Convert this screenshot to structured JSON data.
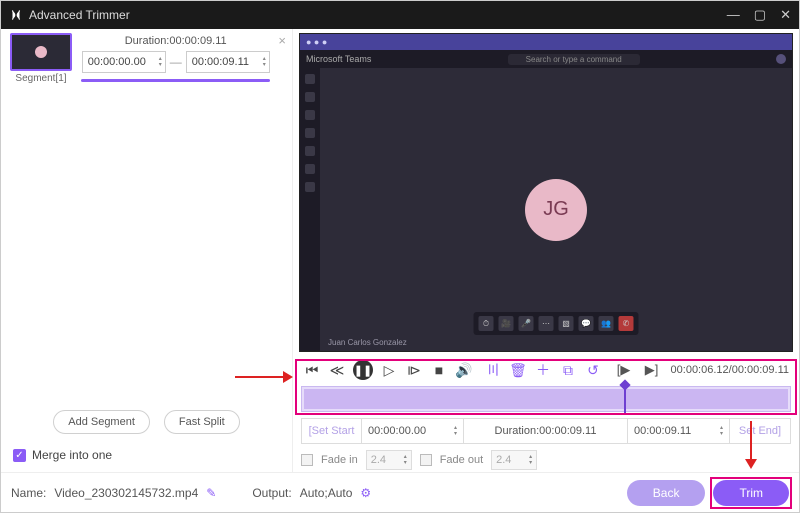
{
  "window": {
    "title": "Advanced Trimmer"
  },
  "segment": {
    "label": "Segment[1]",
    "duration_label": "Duration:00:00:09.11",
    "start": "00:00:00.00",
    "end": "00:00:09.11"
  },
  "sidebar_buttons": {
    "add": "Add Segment",
    "split": "Fast Split"
  },
  "merge_label": "Merge into one",
  "preview": {
    "app_name": "Microsoft Teams",
    "search_placeholder": "Search or type a command",
    "avatar_initials": "JG",
    "presenter_name": "Juan Carlos Gonzalez"
  },
  "time_display": "00:00:06.12/00:00:09.11",
  "range": {
    "set_start_label": "Set Start",
    "start": "00:00:00.00",
    "duration_label": "Duration:00:00:09.11",
    "end": "00:00:09.11",
    "set_end_label": "Set End"
  },
  "fade": {
    "in_label": "Fade in",
    "in_value": "2.4",
    "out_label": "Fade out",
    "out_value": "2.4"
  },
  "bottom": {
    "name_label": "Name:",
    "name_value": "Video_230302145732.mp4",
    "output_label": "Output:",
    "output_value": "Auto;Auto",
    "back": "Back",
    "trim": "Trim"
  }
}
